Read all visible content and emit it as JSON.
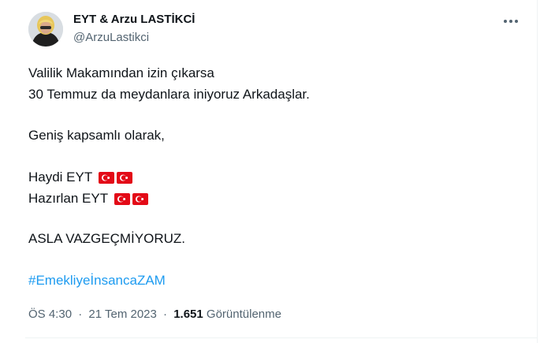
{
  "author": {
    "display_name": "EYT & Arzu LASTİKCİ",
    "handle": "@ArzuLastikci",
    "avatar_icon": "profile-photo"
  },
  "more_icon": "more-dots-icon",
  "tweet": {
    "line1": "Valilik Makamından izin çıkarsa",
    "line2": "30 Temmuz da meydanlara iniyoruz Arkadaşlar.",
    "line3": "Geniş kapsamlı olarak,",
    "line4": "Haydi EYT",
    "line5": "Hazırlan EYT",
    "line6": "ASLA VAZGEÇMİYORUZ.",
    "hashtag": "#EmekliyeİnsancaZAM",
    "flag_emoji": "turkey-flag-icon",
    "flag_color": "#e30a17"
  },
  "meta": {
    "time": "ÖS 4:30",
    "separator": "·",
    "date": "21 Tem 2023",
    "views_count": "1.651",
    "views_label": "Görüntülenme"
  },
  "colors": {
    "text": "#0f1419",
    "secondary": "#536471",
    "link": "#1d9bf0",
    "border": "#eff3f4"
  }
}
